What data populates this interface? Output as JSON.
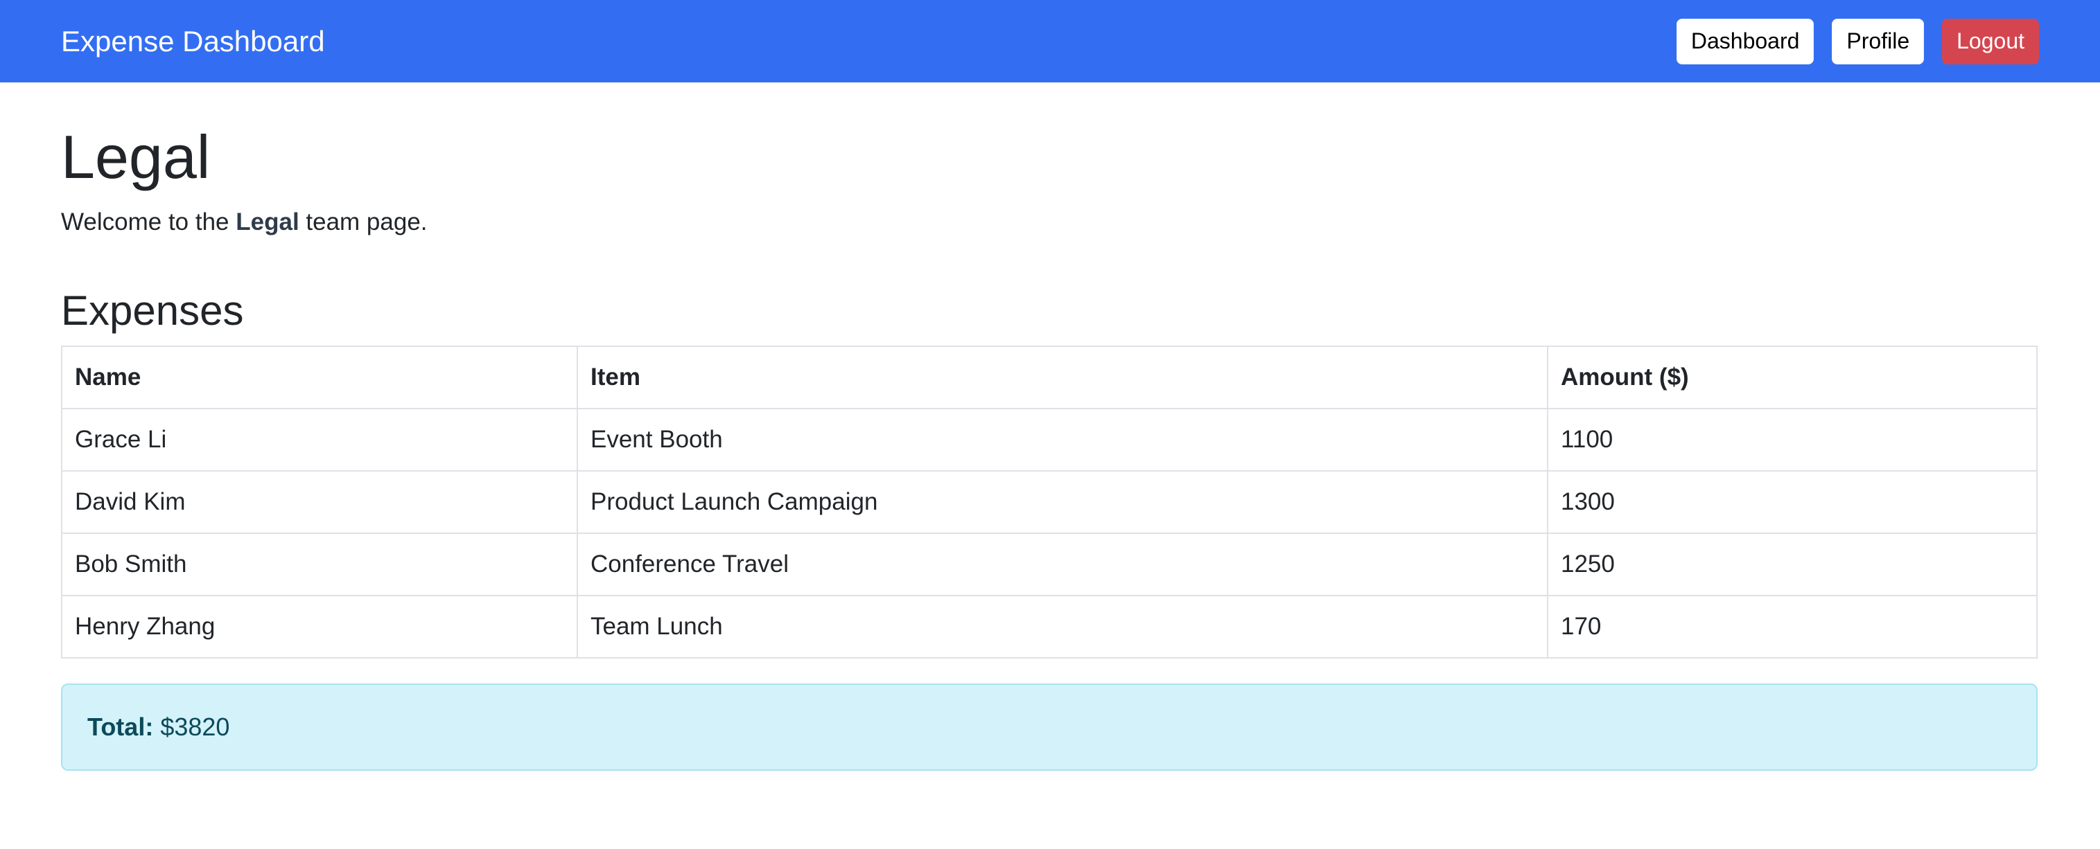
{
  "navbar": {
    "brand": "Expense Dashboard",
    "buttons": {
      "dashboard": "Dashboard",
      "profile": "Profile",
      "logout": "Logout"
    }
  },
  "page": {
    "title": "Legal",
    "welcome_prefix": "Welcome to the ",
    "welcome_team": "Legal",
    "welcome_suffix": " team page."
  },
  "expenses": {
    "heading": "Expenses",
    "columns": [
      "Name",
      "Item",
      "Amount ($)"
    ],
    "rows": [
      {
        "name": "Grace Li",
        "item": "Event Booth",
        "amount": "1100"
      },
      {
        "name": "David Kim",
        "item": "Product Launch Campaign",
        "amount": "1300"
      },
      {
        "name": "Bob Smith",
        "item": "Conference Travel",
        "amount": "1250"
      },
      {
        "name": "Henry Zhang",
        "item": "Team Lunch",
        "amount": "170"
      }
    ]
  },
  "total": {
    "label": "Total:",
    "value": "$3820"
  },
  "colors": {
    "navbar": "#336ef2",
    "logout": "#d5454f",
    "total_bg": "#d4f2fa"
  }
}
